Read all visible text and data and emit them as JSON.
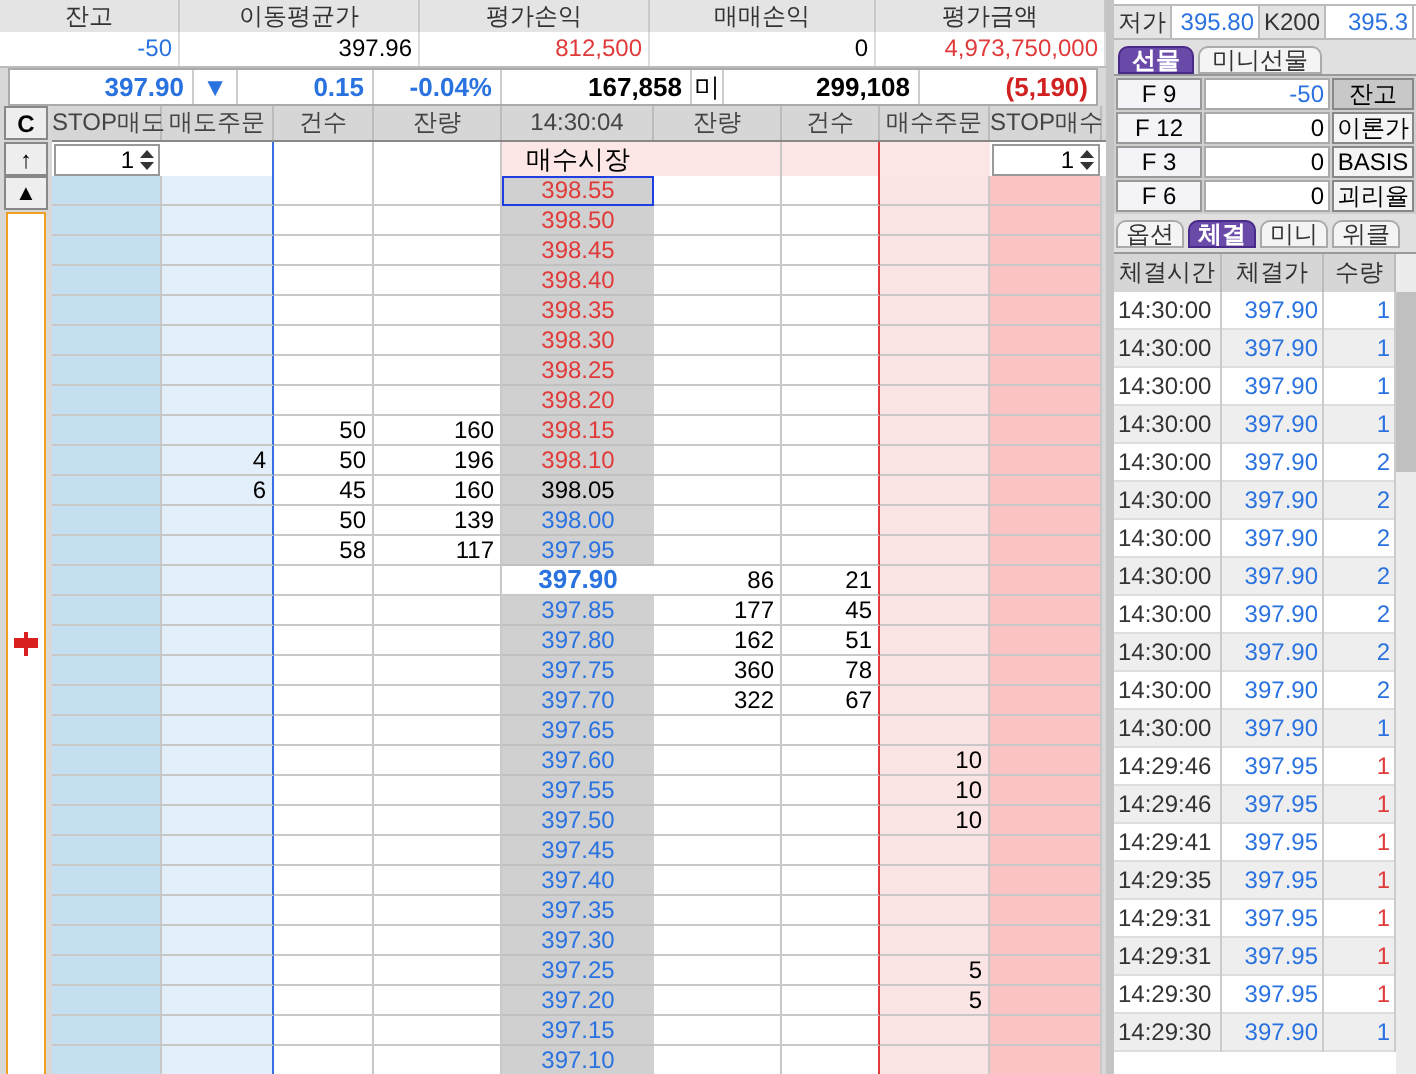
{
  "position": [
    {
      "label": "잔고",
      "value": "-50",
      "color": "#2a72e0"
    },
    {
      "label": "이동평균가",
      "value": "397.96",
      "color": "#000000"
    },
    {
      "label": "평가손익",
      "value": "812,500",
      "color": "#e03a3a"
    },
    {
      "label": "매매손익",
      "value": "0",
      "color": "#000000"
    },
    {
      "label": "평가금액",
      "value": "4,973,750,000",
      "color": "#e03a3a"
    }
  ],
  "quote": {
    "price": "397.90",
    "arrow": "▼",
    "change": "0.15",
    "rate": "-0.04%",
    "volume": "167,858",
    "unit": "미",
    "open_interest": "299,108",
    "oi_change": "(5,190)"
  },
  "order_table": {
    "control": "C",
    "up_button": "↑",
    "top_button": "▲",
    "columns": [
      "STOP매도",
      "매도주문",
      "건수",
      "잔량",
      "14:30:04",
      "잔량",
      "건수",
      "매수주문",
      "STOP매수"
    ],
    "stop_sell_qty": "1",
    "market_buy": "매수시장",
    "stop_buy_qty": "1",
    "rows": [
      {
        "price": "398.55",
        "color": "#e03a3a",
        "current": false,
        "selected": true
      },
      {
        "price": "398.50",
        "color": "#e03a3a",
        "current": false,
        "selected": false
      },
      {
        "price": "398.45",
        "color": "#e03a3a",
        "current": false,
        "selected": false
      },
      {
        "price": "398.40",
        "color": "#e03a3a",
        "current": false,
        "selected": false
      },
      {
        "price": "398.35",
        "color": "#e03a3a",
        "current": false,
        "selected": false
      },
      {
        "price": "398.30",
        "color": "#e03a3a",
        "current": false,
        "selected": false
      },
      {
        "price": "398.25",
        "color": "#e03a3a",
        "current": false,
        "selected": false
      },
      {
        "price": "398.20",
        "color": "#e03a3a",
        "current": false,
        "selected": false
      },
      {
        "price": "398.15",
        "color": "#e03a3a",
        "current": false,
        "selected": false,
        "sell_count": "50",
        "sell_qty": "160"
      },
      {
        "price": "398.10",
        "color": "#e03a3a",
        "current": false,
        "selected": false,
        "sell_orders": "4",
        "sell_count": "50",
        "sell_qty": "196"
      },
      {
        "price": "398.05",
        "color": "#000000",
        "current": false,
        "selected": false,
        "sell_orders": "6",
        "sell_count": "45",
        "sell_qty": "160"
      },
      {
        "price": "398.00",
        "color": "#2a72e0",
        "current": false,
        "selected": false,
        "sell_count": "50",
        "sell_qty": "139"
      },
      {
        "price": "397.95",
        "color": "#2a72e0",
        "current": false,
        "selected": false,
        "sell_count": "58",
        "sell_qty": "117"
      },
      {
        "price": "397.90",
        "color": "#2a72e0",
        "current": true,
        "selected": false,
        "buy_qty": "86",
        "buy_count": "21"
      },
      {
        "price": "397.85",
        "color": "#2a72e0",
        "current": false,
        "selected": false,
        "buy_qty": "177",
        "buy_count": "45"
      },
      {
        "price": "397.80",
        "color": "#2a72e0",
        "current": false,
        "selected": false,
        "buy_qty": "162",
        "buy_count": "51"
      },
      {
        "price": "397.75",
        "color": "#2a72e0",
        "current": false,
        "selected": false,
        "buy_qty": "360",
        "buy_count": "78"
      },
      {
        "price": "397.70",
        "color": "#2a72e0",
        "current": false,
        "selected": false,
        "buy_qty": "322",
        "buy_count": "67"
      },
      {
        "price": "397.65",
        "color": "#2a72e0",
        "current": false,
        "selected": false
      },
      {
        "price": "397.60",
        "color": "#2a72e0",
        "current": false,
        "selected": false,
        "buy_orders": "10"
      },
      {
        "price": "397.55",
        "color": "#2a72e0",
        "current": false,
        "selected": false,
        "buy_orders": "10"
      },
      {
        "price": "397.50",
        "color": "#2a72e0",
        "current": false,
        "selected": false,
        "buy_orders": "10"
      },
      {
        "price": "397.45",
        "color": "#2a72e0",
        "current": false,
        "selected": false
      },
      {
        "price": "397.40",
        "color": "#2a72e0",
        "current": false,
        "selected": false
      },
      {
        "price": "397.35",
        "color": "#2a72e0",
        "current": false,
        "selected": false
      },
      {
        "price": "397.30",
        "color": "#2a72e0",
        "current": false,
        "selected": false
      },
      {
        "price": "397.25",
        "color": "#2a72e0",
        "current": false,
        "selected": false,
        "buy_orders": "5"
      },
      {
        "price": "397.20",
        "color": "#2a72e0",
        "current": false,
        "selected": false,
        "buy_orders": "5"
      },
      {
        "price": "397.15",
        "color": "#2a72e0",
        "current": false,
        "selected": false
      },
      {
        "price": "397.10",
        "color": "#2a72e0",
        "current": false,
        "selected": false
      }
    ]
  },
  "quote_strip": [
    {
      "label": "저가",
      "value": "395.80"
    },
    {
      "label": "K200",
      "value": "395.3"
    }
  ],
  "product_tabs": [
    {
      "label": "선물",
      "selected": true
    },
    {
      "label": "미니선물",
      "selected": false
    }
  ],
  "contracts": [
    {
      "month": "F 9",
      "qty": "-50",
      "color": "#2a72e0",
      "action": "잔고",
      "selected": true
    },
    {
      "month": "F 12",
      "qty": "0",
      "color": "#000000",
      "action": "이론가",
      "selected": false
    },
    {
      "month": "F 3",
      "qty": "0",
      "color": "#000000",
      "action": "BASIS",
      "selected": false
    },
    {
      "month": "F 6",
      "qty": "0",
      "color": "#000000",
      "action": "괴리율",
      "selected": false
    }
  ],
  "trade_tabs": [
    {
      "label": "옵션",
      "selected": false
    },
    {
      "label": "체결",
      "selected": true
    },
    {
      "label": "미니",
      "selected": false
    },
    {
      "label": "위클",
      "selected": false
    }
  ],
  "trades": {
    "columns": [
      "체결시간",
      "체결가",
      "수량"
    ],
    "rows": [
      {
        "time": "14:30:00",
        "price": "397.90",
        "qty": "1",
        "color": "#2a72e0"
      },
      {
        "time": "14:30:00",
        "price": "397.90",
        "qty": "1",
        "color": "#2a72e0"
      },
      {
        "time": "14:30:00",
        "price": "397.90",
        "qty": "1",
        "color": "#2a72e0"
      },
      {
        "time": "14:30:00",
        "price": "397.90",
        "qty": "1",
        "color": "#2a72e0"
      },
      {
        "time": "14:30:00",
        "price": "397.90",
        "qty": "2",
        "color": "#2a72e0"
      },
      {
        "time": "14:30:00",
        "price": "397.90",
        "qty": "2",
        "color": "#2a72e0"
      },
      {
        "time": "14:30:00",
        "price": "397.90",
        "qty": "2",
        "color": "#2a72e0"
      },
      {
        "time": "14:30:00",
        "price": "397.90",
        "qty": "2",
        "color": "#2a72e0"
      },
      {
        "time": "14:30:00",
        "price": "397.90",
        "qty": "2",
        "color": "#2a72e0"
      },
      {
        "time": "14:30:00",
        "price": "397.90",
        "qty": "2",
        "color": "#2a72e0"
      },
      {
        "time": "14:30:00",
        "price": "397.90",
        "qty": "2",
        "color": "#2a72e0"
      },
      {
        "time": "14:30:00",
        "price": "397.90",
        "qty": "1",
        "color": "#2a72e0"
      },
      {
        "time": "14:29:46",
        "price": "397.95",
        "qty": "1",
        "color": "#e03a3a"
      },
      {
        "time": "14:29:46",
        "price": "397.95",
        "qty": "1",
        "color": "#e03a3a"
      },
      {
        "time": "14:29:41",
        "price": "397.95",
        "qty": "1",
        "color": "#e03a3a"
      },
      {
        "time": "14:29:35",
        "price": "397.95",
        "qty": "1",
        "color": "#e03a3a"
      },
      {
        "time": "14:29:31",
        "price": "397.95",
        "qty": "1",
        "color": "#e03a3a"
      },
      {
        "time": "14:29:31",
        "price": "397.95",
        "qty": "1",
        "color": "#e03a3a"
      },
      {
        "time": "14:29:30",
        "price": "397.95",
        "qty": "1",
        "color": "#e03a3a"
      },
      {
        "time": "14:29:30",
        "price": "397.90",
        "qty": "1",
        "color": "#2a72e0"
      }
    ]
  }
}
